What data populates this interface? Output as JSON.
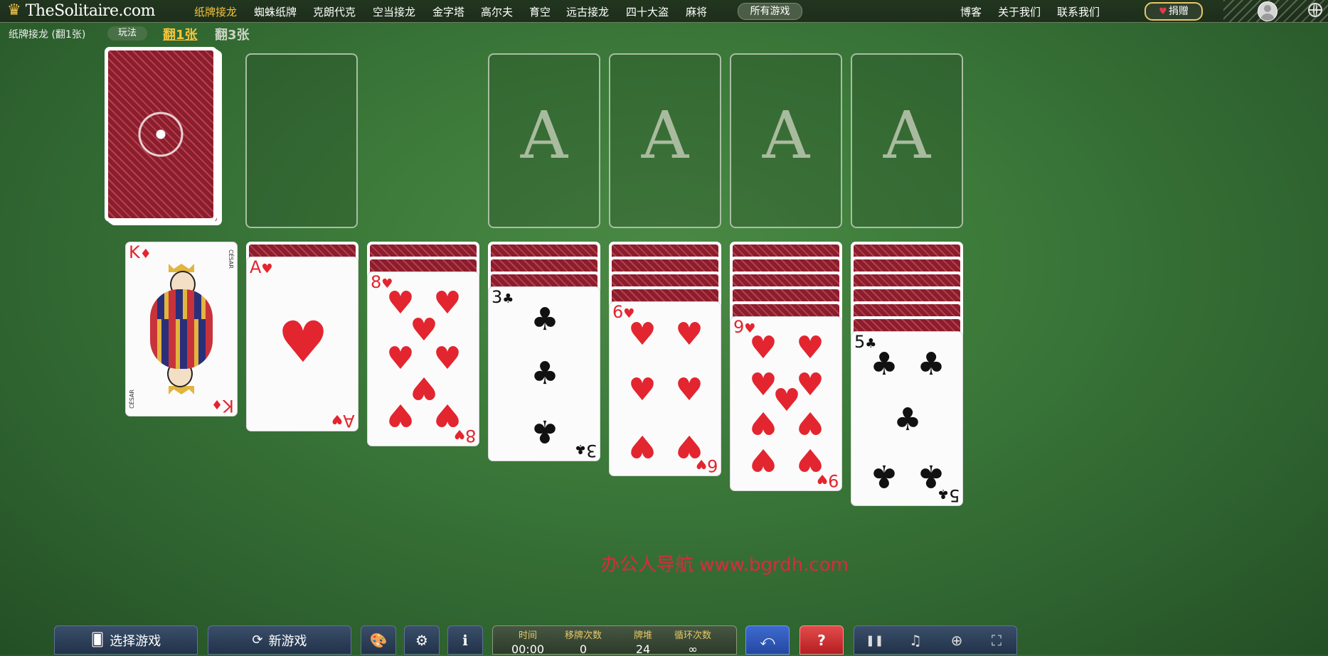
{
  "site": {
    "logo_text": "TheSolitaire.com",
    "crown_icon": "♛"
  },
  "nav": {
    "items": [
      {
        "label": "纸牌接龙",
        "active": true
      },
      {
        "label": "蜘蛛纸牌"
      },
      {
        "label": "克朗代克"
      },
      {
        "label": "空当接龙"
      },
      {
        "label": "金字塔"
      },
      {
        "label": "高尔夫"
      },
      {
        "label": "育空"
      },
      {
        "label": "远古接龙"
      },
      {
        "label": "四十大盗"
      },
      {
        "label": "麻将"
      }
    ],
    "all_games": "所有游戏",
    "blog": "博客",
    "about": "关于我们",
    "contact": "联系我们",
    "donate": "捐赠",
    "donate_icon": "♥"
  },
  "subbar": {
    "title": "纸牌接龙 (翻1张)",
    "rules": "玩法",
    "draw1": "翻1张",
    "draw3": "翻3张"
  },
  "foundations": [
    "A",
    "A",
    "A",
    "A"
  ],
  "tableau": [
    {
      "hidden": 0,
      "face": {
        "rank": "K",
        "suit": "♦",
        "color": "red"
      }
    },
    {
      "hidden": 1,
      "face": {
        "rank": "A",
        "suit": "♥",
        "color": "red"
      }
    },
    {
      "hidden": 2,
      "face": {
        "rank": "8",
        "suit": "♥",
        "color": "red"
      }
    },
    {
      "hidden": 3,
      "face": {
        "rank": "3",
        "suit": "♣",
        "color": "black"
      }
    },
    {
      "hidden": 4,
      "face": {
        "rank": "6",
        "suit": "♥",
        "color": "red"
      }
    },
    {
      "hidden": 5,
      "face": {
        "rank": "9",
        "suit": "♥",
        "color": "red"
      }
    },
    {
      "hidden": 6,
      "face": {
        "rank": "5",
        "suit": "♣",
        "color": "black"
      }
    }
  ],
  "king_card": {
    "maker_top": "CÉSAR",
    "maker_bottom": "CÉSAR"
  },
  "watermark": "办公人导航 www.bgrdh.com",
  "bottom": {
    "choose_game": "选择游戏",
    "new_game": "新游戏",
    "stats": {
      "time_label": "时间",
      "time_value": "00:00",
      "moves_label": "移牌次数",
      "moves_value": "0",
      "stock_label": "牌堆",
      "stock_value": "24",
      "cycles_label": "循环次数",
      "cycles_value": "∞"
    }
  },
  "icons": {
    "palette": "🎨",
    "gear": "⚙",
    "info": "ℹ",
    "undo": "⤺",
    "help": "?",
    "pause": "❚❚",
    "music": "♫",
    "zoom": "⊕",
    "fullscreen": "⛶",
    "choose": "🂠",
    "refresh": "⟳"
  }
}
